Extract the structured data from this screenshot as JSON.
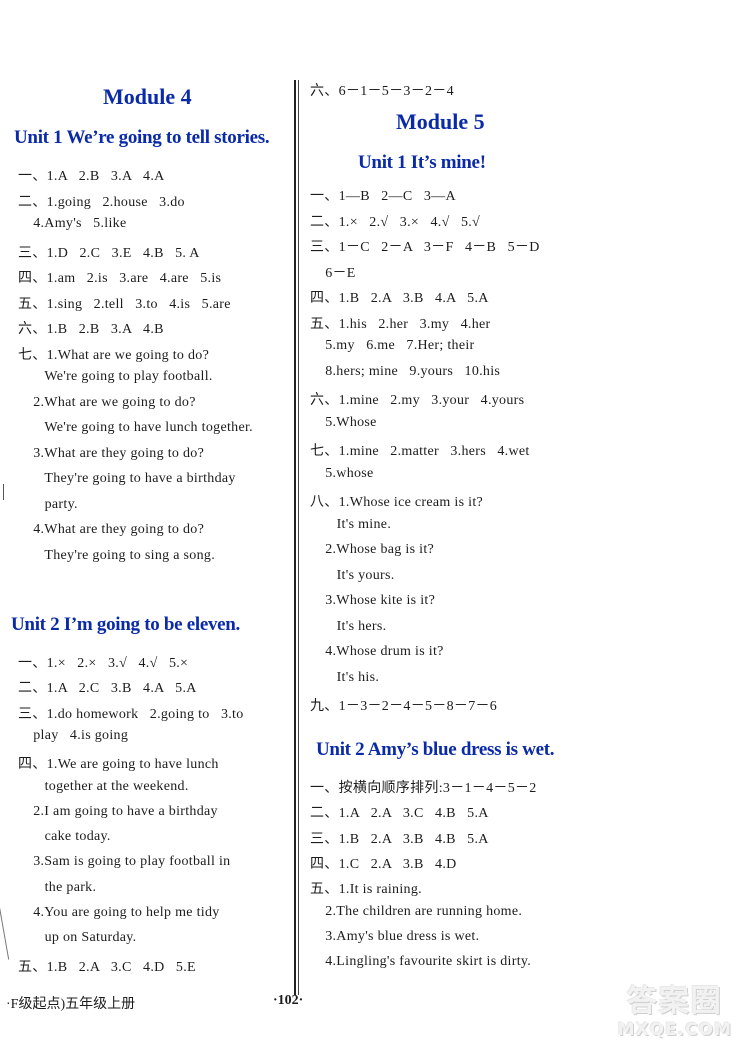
{
  "left": {
    "module_title": "Module 4",
    "unit1_title": "Unit 1   We’re going to tell stories.",
    "unit1_lines": [
      "一、1.A   2.B   3.A   4.A",
      "二、1.going   2.house   3.do",
      "    4.Amy's   5.like",
      "三、1.D   2.C   3.E   4.B   5. A",
      "四、1.am   2.is   3.are   4.are   5.is",
      "五、1.sing   2.tell   3.to   4.is   5.are",
      "六、1.B   2.B   3.A   4.B",
      "七、1.What are we going to do?",
      "       We're going to play football.",
      "    2.What are we going to do?",
      "       We're going to have lunch together.",
      "    3.What are they going to do?",
      "       They're going to have a birthday",
      "       party.",
      "    4.What are they going to do?",
      "       They're going to sing a song."
    ],
    "unit2_title": "Unit 2   I’m going to be eleven.",
    "unit2_lines": [
      "一、1.×   2.×   3.√   4.√   5.×",
      "二、1.A   2.C   3.B   4.A   5.A",
      "三、1.do homework   2.going to   3.to",
      "    play   4.is going",
      "四、1.We are going to have lunch",
      "       together at the weekend.",
      "    2.I am going to have a birthday",
      "       cake today.",
      "    3.Sam is going to play football in",
      "       the park.",
      "    4.You are going to help me tidy",
      "       up on Saturday.",
      "五、1.B   2.A   3.C   4.D   5.E"
    ]
  },
  "right": {
    "carry_line": "六、6－1－5－3－2－4",
    "module_title": "Module 5",
    "unit1_title": "Unit 1   It’s mine!",
    "unit1_lines": [
      "一、1—B   2—C   3—A",
      "二、1.×   2.√   3.×   4.√   5.√",
      "三、1－C   2－A   3－F   4－B   5－D",
      "    6－E",
      "四、1.B   2.A   3.B   4.A   5.A",
      "五、1.his   2.her   3.my   4.her",
      "    5.my   6.me   7.Her; their",
      "    8.hers; mine   9.yours   10.his",
      "六、1.mine   2.my   3.your   4.yours",
      "    5.Whose",
      "七、1.mine   2.matter   3.hers   4.wet",
      "    5.whose",
      "八、1.Whose ice cream is it?",
      "       It's mine.",
      "    2.Whose bag is it?",
      "       It's yours.",
      "    3.Whose kite is it?",
      "       It's hers.",
      "    4.Whose drum is it?",
      "       It's his.",
      "九、1－3－2－4－5－8－7－6"
    ],
    "unit2_title": "Unit 2   Amy’s blue dress is wet.",
    "unit2_lines": [
      "一、按横向顺序排列:3－1－4－5－2",
      "二、1.A   2.A   3.C   4.B   5.A",
      "三、1.B   2.A   3.B   4.B   5.A",
      "四、1.C   2.A   3.B   4.D",
      "五、1.It is raining.",
      "    2.The children are running home.",
      "    3.Amy's blue dress is wet.",
      "    4.Lingling's favourite skirt is dirty."
    ]
  },
  "footer": {
    "book_label": "·F级起点)五年级上册",
    "page_number": "·102·"
  },
  "watermark": {
    "cn": "答案圈",
    "en": "MXQE.COM"
  }
}
